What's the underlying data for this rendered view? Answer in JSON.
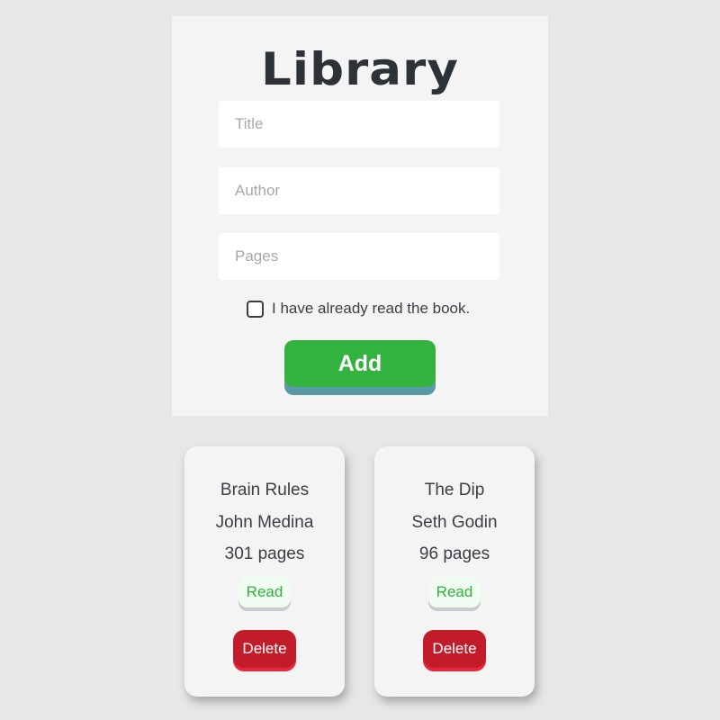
{
  "app": {
    "title": "Library"
  },
  "form": {
    "title_placeholder": "Title",
    "author_placeholder": "Author",
    "pages_placeholder": "Pages",
    "read_checkbox_label": "I have already read the book.",
    "read_checked": false,
    "add_label": "Add"
  },
  "books": [
    {
      "title": "Brain Rules",
      "author": "John Medina",
      "pages": "301 pages",
      "read_label": "Read",
      "delete_label": "Delete"
    },
    {
      "title": "The Dip",
      "author": "Seth Godin",
      "pages": "96 pages",
      "read_label": "Read",
      "delete_label": "Delete"
    }
  ],
  "colors": {
    "background": "#e8e7e5",
    "panel": "#f4f4f4",
    "add_button": "#34b23f",
    "read_text": "#2fb33a",
    "delete_button": "#c21c2a",
    "text": "#3a3f45"
  }
}
